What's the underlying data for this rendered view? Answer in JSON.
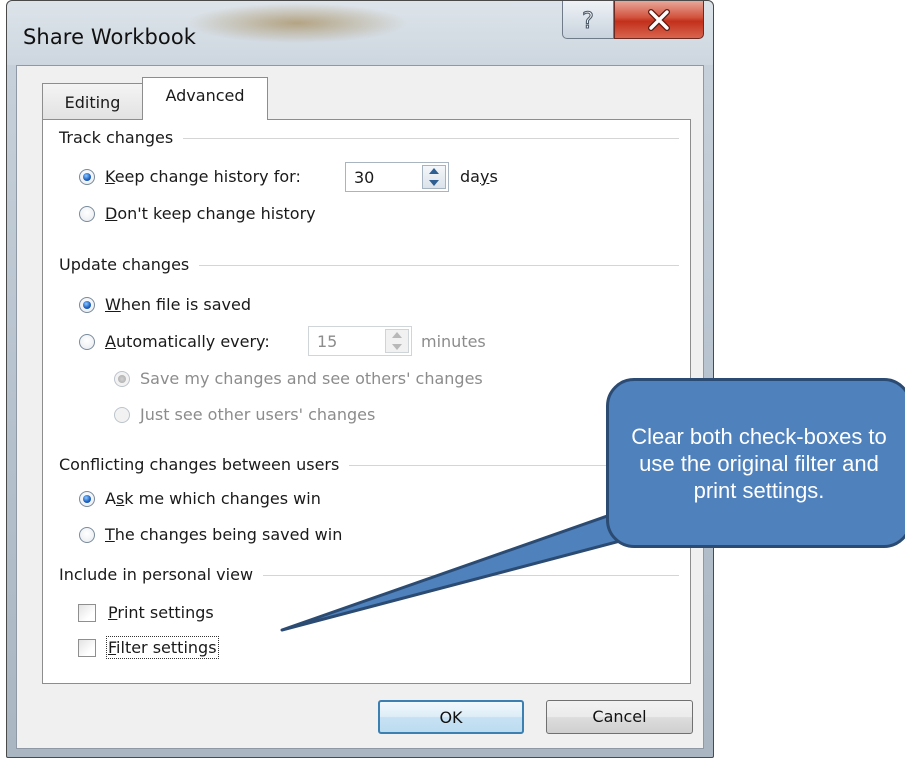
{
  "window": {
    "title": "Share Workbook",
    "help_icon": "question-mark-icon",
    "close_icon": "close-x-icon"
  },
  "tabs": [
    {
      "label": "Editing",
      "selected": false
    },
    {
      "label": "Advanced",
      "selected": true
    }
  ],
  "track_changes": {
    "heading": "Track changes",
    "keep_history": {
      "prefix": "",
      "access": "K",
      "rest": "eep change history for:",
      "checked": true
    },
    "days_value": "30",
    "days_unit": {
      "pre": "da",
      "access": "y",
      "post": "s"
    },
    "dont_keep": {
      "access": "D",
      "rest": "on't keep change history",
      "checked": false
    }
  },
  "update_changes": {
    "heading": "Update changes",
    "when_saved": {
      "access": "W",
      "rest": "hen file is saved",
      "checked": true
    },
    "automatically": {
      "access": "A",
      "rest": "utomatically every:",
      "checked": false
    },
    "minutes_value": "15",
    "minutes_unit": "minutes",
    "save_and_see": {
      "label": "Save my changes and see others' changes",
      "checked": true,
      "disabled": true
    },
    "just_see": {
      "label": "Just see other users' changes",
      "checked": false,
      "disabled": true
    }
  },
  "conflicting": {
    "heading": "Conflicting changes between users",
    "ask_me": {
      "pre": "A",
      "access": "s",
      "post": "k me which changes win",
      "checked": true
    },
    "being_saved": {
      "access": "T",
      "rest": "he changes being saved win",
      "checked": false
    }
  },
  "personal_view": {
    "heading": "Include in personal view",
    "print": {
      "access": "P",
      "rest": "rint settings",
      "checked": false
    },
    "filter": {
      "access": "F",
      "rest": "ilter settings",
      "checked": false
    }
  },
  "buttons": {
    "ok": "OK",
    "cancel": "Cancel"
  },
  "callout": {
    "text": "Clear both check-boxes to use the original filter and print settings.",
    "fill_color": "#4f81bd",
    "border_color": "#2b4b72"
  }
}
